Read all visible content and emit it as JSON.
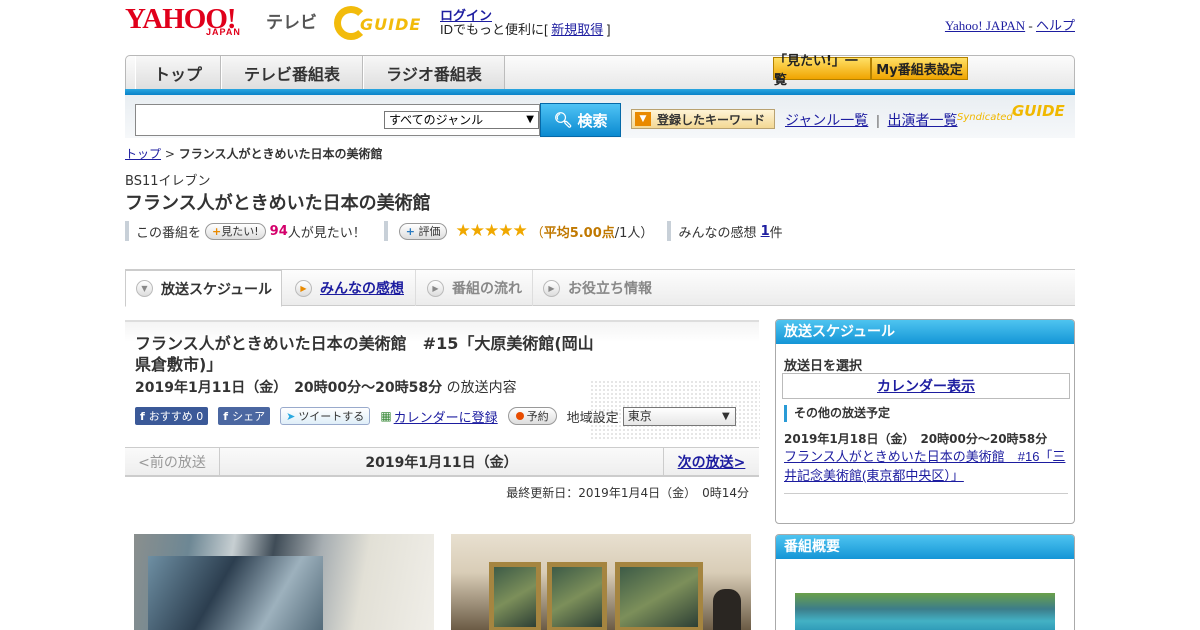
{
  "header": {
    "logo_yahoo": "YAHOO!",
    "logo_japan": "JAPAN",
    "logo_tv": "テレビ",
    "logo_gguide": "GUIDE",
    "login_label": "ログイン",
    "login_sub_prefix": "IDでもっと便利に[",
    "register_label": "新規取得",
    "login_sub_suffix": "]",
    "yahoo_japan_link": "Yahoo! JAPAN",
    "help_link": "ヘルプ"
  },
  "nav": {
    "tabs": [
      "トップ",
      "テレビ番組表",
      "ラジオ番組表"
    ],
    "mitai_list": "「見たい!」一覧",
    "my_bangumi": "My番組表設定"
  },
  "search": {
    "genre_selected": "すべてのジャンル",
    "search_button": "検索",
    "keyword_button": "登録したキーワード",
    "genre_list_link": "ジャンル一覧",
    "performer_list_link": "出演者一覧",
    "syndicated": "Syndicated",
    "syndicated_logo": "GUIDE"
  },
  "breadcrumb": {
    "top": "トップ",
    "current": "フランス人がときめいた日本の美術館"
  },
  "program": {
    "channel": "BS11イレブン",
    "title": "フランス人がときめいた日本の美術館",
    "this_program": "この番組を",
    "mitai_button": "見たい!",
    "mitai_count": "94",
    "mitai_suffix": "人が見たい！",
    "rate_button": "評価",
    "stars": "★★★★★",
    "avg_open": "（",
    "avg_label": "平均5.00点",
    "avg_count": "/1人）",
    "impressions_label": "みんなの感想",
    "impressions_count": "1",
    "impressions_suffix": "件"
  },
  "tabs": [
    "放送スケジュール",
    "みんなの感想",
    "番組の流れ",
    "お役立ち情報"
  ],
  "episode": {
    "title": "フランス人がときめいた日本の美術館　#15「大原美術館(岡山県倉敷市)」",
    "datetime": "2019年1月11日（金）　20時00分～20時58分",
    "datetime_suffix": "の放送内容",
    "fb_recommend": "おすすめ 0",
    "fb_share": "シェア",
    "tweet": "ツイートする",
    "calendar_register": "カレンダーに登録",
    "reserve": "予約",
    "region_label": "地域設定",
    "region_value": "東京"
  },
  "pager": {
    "prev": "<前の放送",
    "date": "2019年1月11日（金）",
    "next": "次の放送>"
  },
  "updated": "最終更新日：2019年1月4日（金）　0時14分",
  "sidebar": {
    "schedule_title": "放送スケジュール",
    "select_date": "放送日を選択",
    "calendar_button": "カレンダー表示",
    "other_schedule": "その他の放送予定",
    "next_time": "2019年1月18日（金）　20時00分～20時58分",
    "next_title": "フランス人がときめいた日本の美術館　#16「三井記念美術館(東京都中央区）」",
    "summary_title": "番組概要"
  }
}
